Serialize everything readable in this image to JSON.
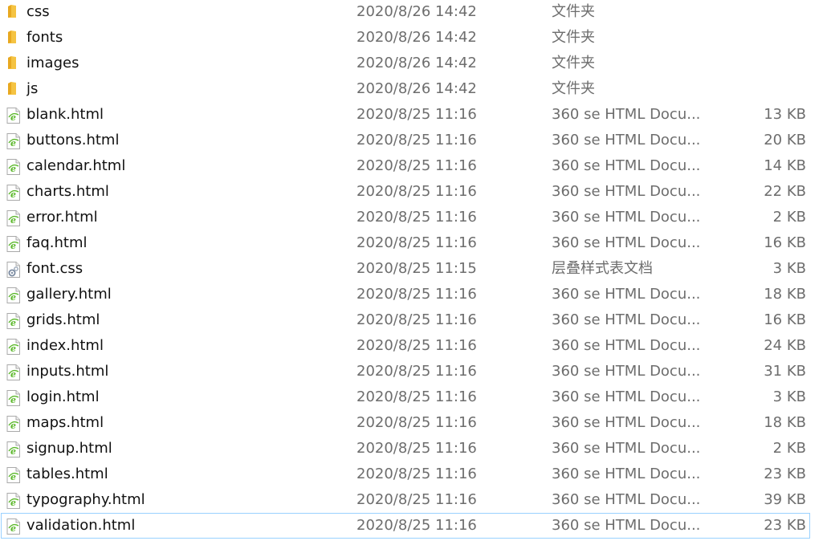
{
  "files": [
    {
      "name": "css",
      "date": "2020/8/26 14:42",
      "type": "文件夹",
      "size": "",
      "icon": "folder-icon"
    },
    {
      "name": "fonts",
      "date": "2020/8/26 14:42",
      "type": "文件夹",
      "size": "",
      "icon": "folder-icon"
    },
    {
      "name": "images",
      "date": "2020/8/26 14:42",
      "type": "文件夹",
      "size": "",
      "icon": "folder-icon"
    },
    {
      "name": "js",
      "date": "2020/8/26 14:42",
      "type": "文件夹",
      "size": "",
      "icon": "folder-icon"
    },
    {
      "name": "blank.html",
      "date": "2020/8/25 11:16",
      "type": "360 se HTML Docu...",
      "size": "13 KB",
      "icon": "html-file-icon"
    },
    {
      "name": "buttons.html",
      "date": "2020/8/25 11:16",
      "type": "360 se HTML Docu...",
      "size": "20 KB",
      "icon": "html-file-icon"
    },
    {
      "name": "calendar.html",
      "date": "2020/8/25 11:16",
      "type": "360 se HTML Docu...",
      "size": "14 KB",
      "icon": "html-file-icon"
    },
    {
      "name": "charts.html",
      "date": "2020/8/25 11:16",
      "type": "360 se HTML Docu...",
      "size": "22 KB",
      "icon": "html-file-icon"
    },
    {
      "name": "error.html",
      "date": "2020/8/25 11:16",
      "type": "360 se HTML Docu...",
      "size": "2 KB",
      "icon": "html-file-icon"
    },
    {
      "name": "faq.html",
      "date": "2020/8/25 11:16",
      "type": "360 se HTML Docu...",
      "size": "16 KB",
      "icon": "html-file-icon"
    },
    {
      "name": "font.css",
      "date": "2020/8/25 11:15",
      "type": "层叠样式表文档",
      "size": "3 KB",
      "icon": "css-file-icon"
    },
    {
      "name": "gallery.html",
      "date": "2020/8/25 11:16",
      "type": "360 se HTML Docu...",
      "size": "18 KB",
      "icon": "html-file-icon"
    },
    {
      "name": "grids.html",
      "date": "2020/8/25 11:16",
      "type": "360 se HTML Docu...",
      "size": "16 KB",
      "icon": "html-file-icon"
    },
    {
      "name": "index.html",
      "date": "2020/8/25 11:16",
      "type": "360 se HTML Docu...",
      "size": "24 KB",
      "icon": "html-file-icon"
    },
    {
      "name": "inputs.html",
      "date": "2020/8/25 11:16",
      "type": "360 se HTML Docu...",
      "size": "31 KB",
      "icon": "html-file-icon"
    },
    {
      "name": "login.html",
      "date": "2020/8/25 11:16",
      "type": "360 se HTML Docu...",
      "size": "3 KB",
      "icon": "html-file-icon"
    },
    {
      "name": "maps.html",
      "date": "2020/8/25 11:16",
      "type": "360 se HTML Docu...",
      "size": "18 KB",
      "icon": "html-file-icon"
    },
    {
      "name": "signup.html",
      "date": "2020/8/25 11:16",
      "type": "360 se HTML Docu...",
      "size": "2 KB",
      "icon": "html-file-icon"
    },
    {
      "name": "tables.html",
      "date": "2020/8/25 11:16",
      "type": "360 se HTML Docu...",
      "size": "23 KB",
      "icon": "html-file-icon"
    },
    {
      "name": "typography.html",
      "date": "2020/8/25 11:16",
      "type": "360 se HTML Docu...",
      "size": "39 KB",
      "icon": "html-file-icon"
    },
    {
      "name": "validation.html",
      "date": "2020/8/25 11:16",
      "type": "360 se HTML Docu...",
      "size": "23 KB",
      "icon": "html-file-icon",
      "selected": true
    }
  ],
  "colors": {
    "folder": "#f5c342",
    "html_icon_accent": "#5cb82c",
    "selection_border": "#99d1ff",
    "meta_text": "#6d6d6d"
  }
}
